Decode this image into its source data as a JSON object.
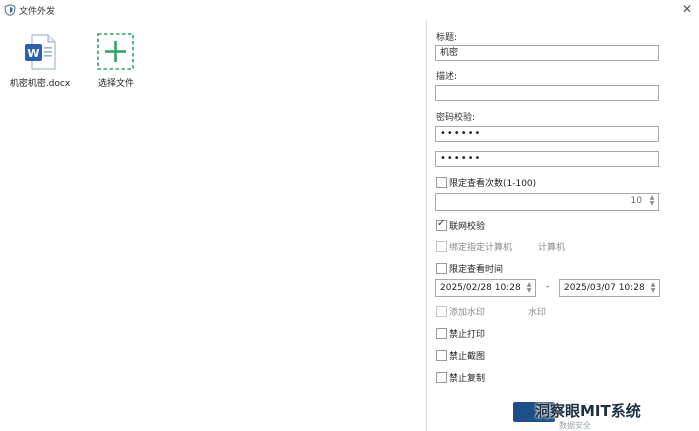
{
  "window": {
    "title": "文件外发",
    "close_glyph": "✕"
  },
  "files": [
    {
      "name": "机密机密.docx",
      "icon": "word-doc-icon"
    },
    {
      "name": "选择文件",
      "icon": "add-file-plus-icon"
    }
  ],
  "form": {
    "title_label": "标题:",
    "title_value": "机密",
    "desc_label": "描述:",
    "desc_value": "",
    "password_label": "密码校验:",
    "password_value": "••••••",
    "password_confirm_value": "••••••",
    "limit_views": {
      "label": "限定查看次数(1-100)",
      "checked": false
    },
    "view_count": "10",
    "network_check": {
      "label": "联网校验",
      "checked": true
    },
    "bind_computer": {
      "label": "绑定指定计算机",
      "checked": false,
      "aside": "计算机"
    },
    "limit_time": {
      "label": "限定查看时间",
      "checked": false
    },
    "start_time": "2025/02/28 10:28",
    "end_time": "2025/03/07 10:28",
    "date_separator": "-",
    "add_watermark": {
      "label": "添加水印",
      "checked": false,
      "aside": "水印"
    },
    "no_print": {
      "label": "禁止打印",
      "checked": false
    },
    "no_screenshot": {
      "label": "禁止截图",
      "checked": false
    },
    "no_copy": {
      "label": "禁止复制",
      "checked": false
    }
  },
  "overlay_watermark": {
    "text": "洞察眼MIT系统",
    "sub": "数据安全"
  },
  "colors": {
    "word_blue": "#2b5fb4",
    "add_green": "#2fa56a",
    "watermark_blue": "#1c4f86"
  }
}
